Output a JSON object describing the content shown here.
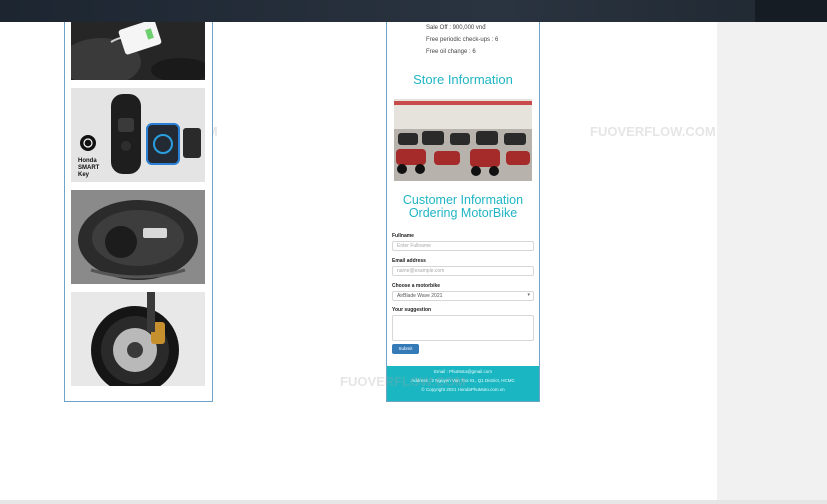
{
  "gallery": {
    "photos": [
      {
        "name": "phone-charging-compartment"
      },
      {
        "name": "honda-smart-key",
        "caption_line1": "Honda",
        "caption_line2": "SMART",
        "caption_line3": "Key"
      },
      {
        "name": "under-seat-storage"
      },
      {
        "name": "front-wheel-disc-brake"
      }
    ]
  },
  "specs": {
    "sale_off": "Sale Off : 900,000 vnđ",
    "checkups": "Free periodic check-ups : 6",
    "oil_change": "Free oil change : 6"
  },
  "store": {
    "heading": "Store Information"
  },
  "order_form": {
    "heading_line1": "Customer Information",
    "heading_line2": "Ordering MotorBike",
    "fullname_label": "Fullname",
    "fullname_placeholder": "Enter Fullname",
    "email_label": "Email address",
    "email_placeholder": "name@example.com",
    "motorbike_label": "Choose a motorbike",
    "motorbike_selected": "AirBlade Wave 2021",
    "suggestion_label": "Your suggestion",
    "submit_label": "Submit"
  },
  "footer": {
    "email": "Email : PhuMoto@gmail.com",
    "address": "Address : 2 Nguyen Van Troi St., Q1 District, HCMC",
    "copyright": "© Copyright 2021 HondaPhuMoto.com.vn"
  },
  "watermark": {
    "text": "FUOVERFLOW.COM"
  }
}
